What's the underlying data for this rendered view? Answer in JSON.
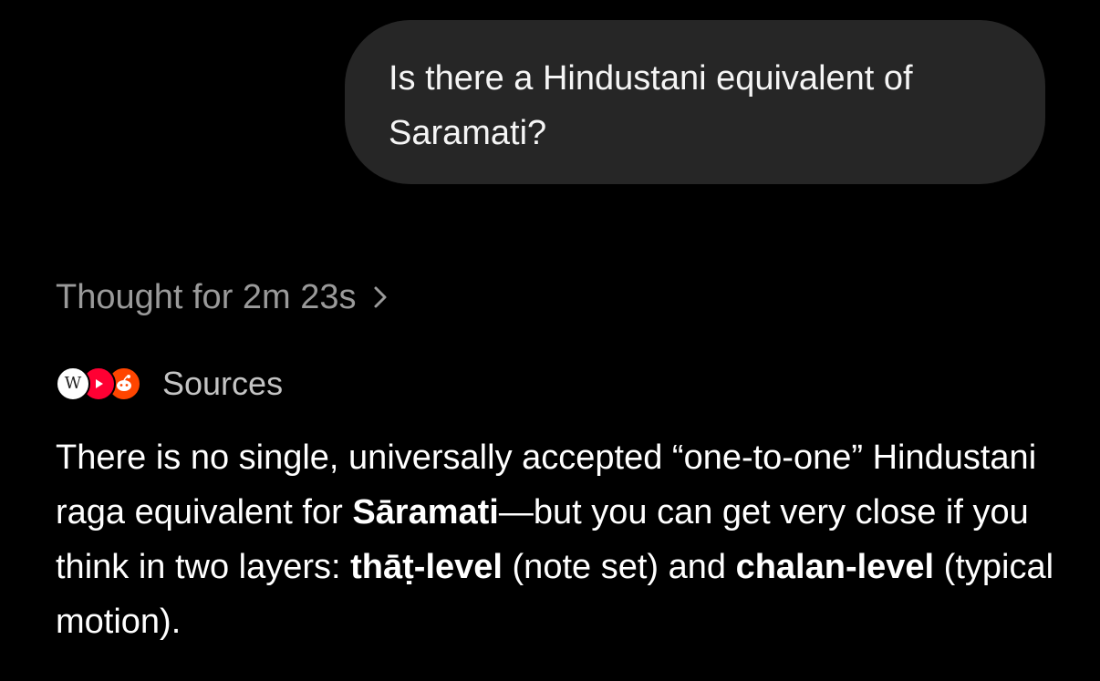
{
  "user_message": {
    "text": "Is there a Hindustani equivalent of Saramati?"
  },
  "thought": {
    "label": "Thought for 2m 23s",
    "icon": "chevron-right-icon"
  },
  "sources": {
    "label": "Sources",
    "favicons": [
      "wikipedia-icon",
      "youtube-icon",
      "reddit-icon"
    ],
    "wiki_glyph": "W"
  },
  "answer": {
    "part1": "There is no single, universally accepted “one-to-one” Hindustani raga equivalent for ",
    "bold1": "Sāramati",
    "part2": "—but you can get very close if you think in two layers: ",
    "bold2": "thāṭ-level",
    "part3": " (note set) and ",
    "bold3": "chalan-level",
    "part4": " (typical motion)."
  },
  "colors": {
    "background": "#000000",
    "bubble": "#262626",
    "muted_text": "#9a9a9a",
    "youtube_red": "#ff0033",
    "reddit_orange": "#ff4500"
  }
}
